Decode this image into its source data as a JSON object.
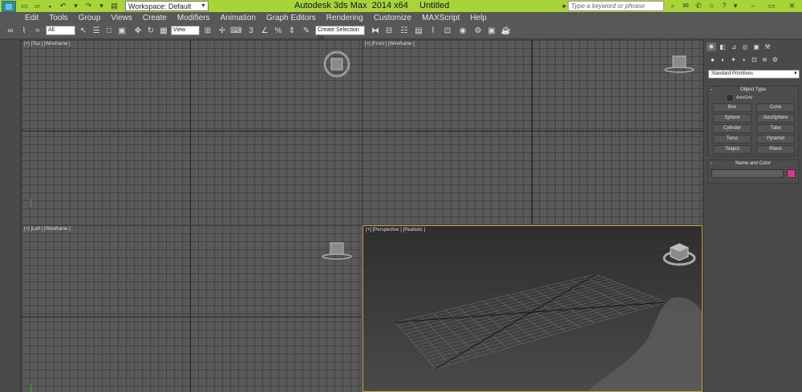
{
  "titlebar": {
    "workspace_label": "Workspace: Default",
    "app_title": "Autodesk 3ds Max  2014 x64",
    "doc_title": "Untitled",
    "search_placeholder": "Type a keyword or phrase",
    "accent_color": "#a9d437"
  },
  "menu": [
    {
      "label": "Edit"
    },
    {
      "label": "Tools"
    },
    {
      "label": "Group"
    },
    {
      "label": "Views"
    },
    {
      "label": "Create"
    },
    {
      "label": "Modifiers"
    },
    {
      "label": "Animation"
    },
    {
      "label": "Graph Editors"
    },
    {
      "label": "Rendering"
    },
    {
      "label": "Customize"
    },
    {
      "label": "MAXScript"
    },
    {
      "label": "Help"
    }
  ],
  "toolbar": {
    "filter_value": "All",
    "refcoord_value": "View",
    "selection_set_placeholder": "Create Selection Se"
  },
  "viewports": {
    "top": {
      "label": "[+] [Top ] [Wireframe ]"
    },
    "front": {
      "label": "[+] [Front ] [Wireframe ]"
    },
    "left": {
      "label": "[+] [Left ] [Wireframe ]"
    },
    "perspective": {
      "label": "[+] [Perspective ] [Realistic ]",
      "border_color": "#c9a63a"
    }
  },
  "command_panel": {
    "primitive_type": "Standard Primitives",
    "object_type_title": "Object Type",
    "autogrid_label": "AutoGrid",
    "buttons": [
      {
        "label": "Box"
      },
      {
        "label": "Cone"
      },
      {
        "label": "Sphere"
      },
      {
        "label": "GeoSphere"
      },
      {
        "label": "Cylinder"
      },
      {
        "label": "Tube"
      },
      {
        "label": "Torus"
      },
      {
        "label": "Pyramid"
      },
      {
        "label": "Teapot"
      },
      {
        "label": "Plane"
      }
    ],
    "name_color_title": "Name and Color",
    "object_color": "#cc3d8c"
  }
}
